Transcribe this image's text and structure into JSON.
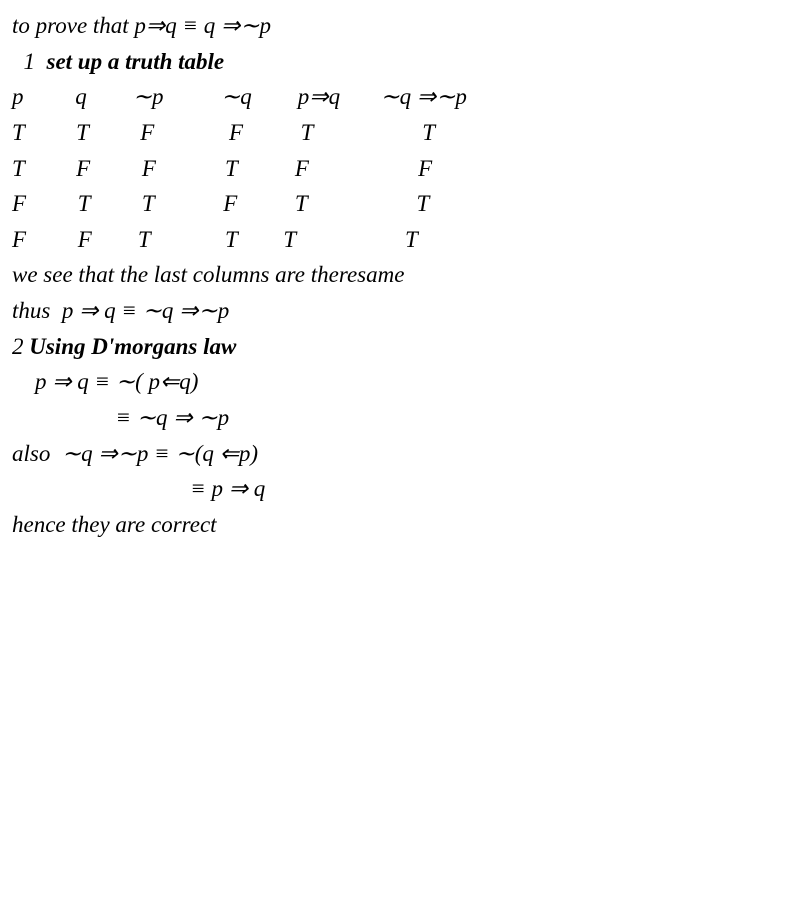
{
  "line1": "to prove that p⇒q ≡ q ⇒∼p",
  "line2": "  1  ",
  "line2b": "set up a truth table",
  "line3": "p         q        ∼p          ∼q        p⇒q       ∼q ⇒∼p",
  "line4": "T         T         F             F          T                   T",
  "line5": "T         F         F            T          F                   F",
  "line6": "F         T         T            F          T                   T",
  "line7": "F         F        T             T        T                   T",
  "line8": "we see that the last columns are theresame",
  "line9": "thus  p ⇒ q ≡ ∼q ⇒∼p",
  "line10a": "2 ",
  "line10b": "Using D'morgans law",
  "line11": "    p ⇒ q ≡ ∼( p⇐q)",
  "line12": "                  ≡ ∼q ⇒ ∼p",
  "line13": "also  ∼q ⇒∼p ≡ ∼(q ⇐p)",
  "line14": "                               ≡ p ⇒ q",
  "line15": "hence they are correct"
}
